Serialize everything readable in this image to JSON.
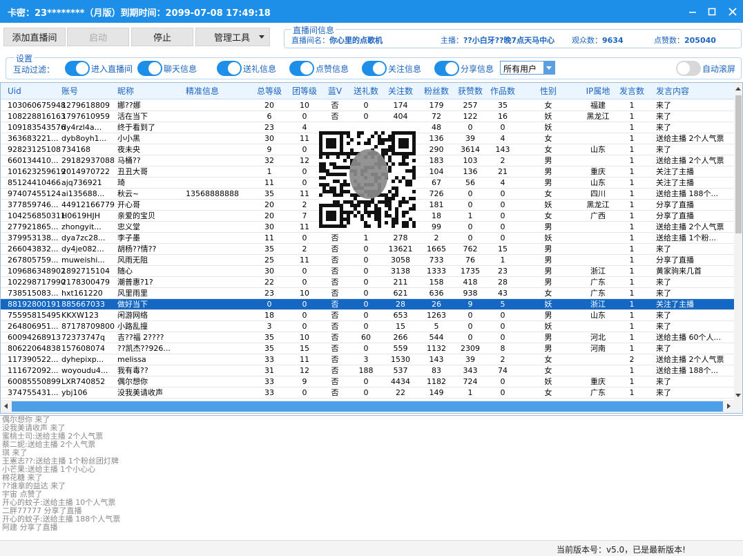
{
  "title": "卡密：23********（月版）到期时间：2099-07-08 17:49:18",
  "toolbar": {
    "add_room": "添加直播间",
    "start": "启动",
    "stop": "停止",
    "tools": "管理工具"
  },
  "room": {
    "legend": "直播间信息",
    "name_label": "直播间名：",
    "name": "你心里的点歌机",
    "anchor_label": "主播：",
    "anchor": "??小白牙??晚7点天马中心",
    "viewers_label": "观众数：",
    "viewers": "9634",
    "likes_label": "点赞数：",
    "likes": "205040"
  },
  "settings": {
    "legend": "设置",
    "filter_label": "互动过滤：",
    "toggles": [
      {
        "label": "进入直播间",
        "on": true
      },
      {
        "label": "聊天信息",
        "on": true
      },
      {
        "label": "送礼信息",
        "on": true
      },
      {
        "label": "点赞信息",
        "on": true
      },
      {
        "label": "关注信息",
        "on": true
      },
      {
        "label": "分享信息",
        "on": true
      }
    ],
    "user_select": "所有用户",
    "auto_scroll": {
      "label": "自动滚屏",
      "on": false
    }
  },
  "columns": [
    "Uid",
    "账号",
    "昵称",
    "精准信息",
    "总等级",
    "团等级",
    "蓝V",
    "送礼数",
    "关注数",
    "粉丝数",
    "获赞数",
    "作品数",
    "性别",
    "IP属地",
    "发言数",
    "发言内容"
  ],
  "rows": [
    [
      "103060675948",
      "1279618809",
      "娜??娜",
      "",
      "20",
      "10",
      "否",
      "0",
      "174",
      "179",
      "257",
      "35",
      "女",
      "福建",
      "1",
      "来了"
    ],
    [
      "108228816163",
      "1797610959",
      "活在当下",
      "",
      "6",
      "0",
      "否",
      "0",
      "404",
      "72",
      "122",
      "16",
      "妖",
      "黑龙江",
      "1",
      "来了"
    ],
    [
      "109183543576",
      "dy4rzl4a...",
      "终于看到了",
      "",
      "23",
      "4",
      "",
      "",
      "",
      "48",
      "0",
      "0",
      "妖",
      "",
      "1",
      "来了"
    ],
    [
      "363683221...",
      "dyb8oyh1...",
      "小小黑",
      "",
      "30",
      "11",
      "",
      "",
      "",
      "136",
      "39",
      "4",
      "女",
      "",
      "1",
      "送给主播 2个人气票"
    ],
    [
      "92823125108",
      "734168",
      "夜未央",
      "",
      "9",
      "0",
      "",
      "",
      "",
      "290",
      "3614",
      "143",
      "女",
      "山东",
      "1",
      "来了"
    ],
    [
      "660134410...",
      "29182937088",
      "马桶??",
      "",
      "32",
      "12",
      "",
      "",
      "",
      "183",
      "103",
      "2",
      "男",
      "",
      "1",
      "送给主播 2个人气票"
    ],
    [
      "101623259619",
      "2014970722",
      "丑丑大哥",
      "",
      "1",
      "0",
      "",
      "",
      "",
      "104",
      "136",
      "21",
      "男",
      "重庆",
      "1",
      "关注了主播"
    ],
    [
      "85124410466",
      "ajq736921",
      "琦",
      "",
      "11",
      "0",
      "",
      "",
      "",
      "67",
      "56",
      "4",
      "男",
      "山东",
      "1",
      "关注了主播"
    ],
    [
      "97407455124",
      "ai135688...",
      "秋云~",
      "13568888888",
      "35",
      "11",
      "",
      "",
      "",
      "726",
      "0",
      "0",
      "女",
      "四川",
      "1",
      "送给主播 188个..."
    ],
    [
      "377859746...",
      "44912166779",
      "开心哥",
      "",
      "20",
      "2",
      "",
      "",
      "",
      "181",
      "0",
      "0",
      "妖",
      "黑龙江",
      "1",
      "分享了直播"
    ],
    [
      "104256850311",
      "H0619HJH",
      "亲爱的宝贝",
      "",
      "20",
      "7",
      "",
      "",
      "",
      "18",
      "1",
      "0",
      "女",
      "广西",
      "1",
      "分享了直播"
    ],
    [
      "277921865...",
      "zhongyit...",
      "忠义堂",
      "",
      "30",
      "11",
      "",
      "",
      "",
      "99",
      "0",
      "0",
      "男",
      "",
      "1",
      "送给主播 2个人气票"
    ],
    [
      "379953138...",
      "dya7zc28...",
      "李子墨",
      "",
      "11",
      "0",
      "否",
      "1",
      "278",
      "2",
      "0",
      "0",
      "妖",
      "",
      "1",
      "送给主播 1个粉..."
    ],
    [
      "266043832...",
      "dy4je082...",
      "胡杨??情??",
      "",
      "35",
      "2",
      "否",
      "0",
      "13621",
      "1665",
      "762",
      "15",
      "男",
      "",
      "1",
      "来了"
    ],
    [
      "267805759...",
      "muweishi...",
      "风雨无阻",
      "",
      "25",
      "11",
      "否",
      "0",
      "3058",
      "733",
      "76",
      "1",
      "男",
      "",
      "1",
      "分享了直播"
    ],
    [
      "109686348902",
      "1892715104",
      "随心",
      "",
      "30",
      "0",
      "否",
      "0",
      "3138",
      "1333",
      "1735",
      "23",
      "男",
      "浙江",
      "1",
      "黄家驹来几首"
    ],
    [
      "102298717990",
      "2178300479",
      "潮普惠?1?",
      "",
      "22",
      "0",
      "否",
      "0",
      "211",
      "158",
      "418",
      "28",
      "男",
      "广东",
      "1",
      "来了"
    ],
    [
      "738515083...",
      "hxt161220",
      "风里雨里",
      "",
      "23",
      "10",
      "否",
      "0",
      "621",
      "636",
      "938",
      "43",
      "女",
      "广东",
      "1",
      "来了"
    ],
    [
      "88192800191",
      "885667033",
      "做好当下",
      "",
      "0",
      "0",
      "否",
      "0",
      "28",
      "26",
      "9",
      "5",
      "妖",
      "浙江",
      "1",
      "关注了主播"
    ],
    [
      "75595815495",
      "KKXW123",
      "闲游网络",
      "",
      "18",
      "0",
      "否",
      "0",
      "653",
      "1263",
      "0",
      "0",
      "男",
      "山东",
      "1",
      "来了"
    ],
    [
      "264806951...",
      "87178709800",
      "小路乱撞",
      "",
      "3",
      "0",
      "否",
      "0",
      "15",
      "5",
      "0",
      "0",
      "妖",
      "",
      "1",
      "来了"
    ],
    [
      "60094268913",
      "72373747q",
      "吉??福 2????",
      "",
      "35",
      "10",
      "否",
      "60",
      "266",
      "544",
      "0",
      "0",
      "男",
      "河北",
      "1",
      "送给主播 60个人..."
    ],
    [
      "80622064838",
      "157608074",
      "??凯杰??926...",
      "",
      "35",
      "15",
      "否",
      "0",
      "559",
      "1132",
      "2309",
      "8",
      "男",
      "河南",
      "1",
      "来了"
    ],
    [
      "117390522...",
      "dyhepixp...",
      "melissa",
      "",
      "33",
      "11",
      "否",
      "3",
      "1530",
      "143",
      "39",
      "2",
      "女",
      "",
      "2",
      "送给主播 2个人气票"
    ],
    [
      "111672092...",
      "woyoudu4...",
      "我有毒??",
      "",
      "31",
      "12",
      "否",
      "188",
      "537",
      "83",
      "343",
      "74",
      "女",
      "",
      "1",
      "送给主播 188个..."
    ],
    [
      "60085550899",
      "LXR740852",
      "偶尔想你",
      "",
      "33",
      "9",
      "否",
      "0",
      "4434",
      "1182",
      "724",
      "0",
      "妖",
      "重庆",
      "1",
      "来了"
    ],
    [
      "374755431...",
      "ybj106",
      "没我美请收声",
      "",
      "33",
      "0",
      "否",
      "0",
      "22",
      "149",
      "1",
      "0",
      "女",
      "广东",
      "1",
      "来了"
    ]
  ],
  "selected_row": 18,
  "log": [
    "偶尔想你 来了",
    "没我美请收声 来了",
    "蜜桃士司:送给主播 2个人气票",
    "蔡二妮:送给主播 2个人气票",
    "琪 来了",
    "王憲志??:送给主播 1个粉丝团灯牌",
    "小芒果:送给主播 1个小心心",
    "棉花糖 来了",
    "??谁拿的益达 来了",
    "宇宙 点赞了",
    "开心的蚊子:送给主播 10个人气票",
    "二胖77777 分享了直播",
    "开心的蚊子:送给主播 188个人气票",
    "阿建 分享了直播"
  ],
  "status": "当前版本号：v5.0，已是最新版本!"
}
